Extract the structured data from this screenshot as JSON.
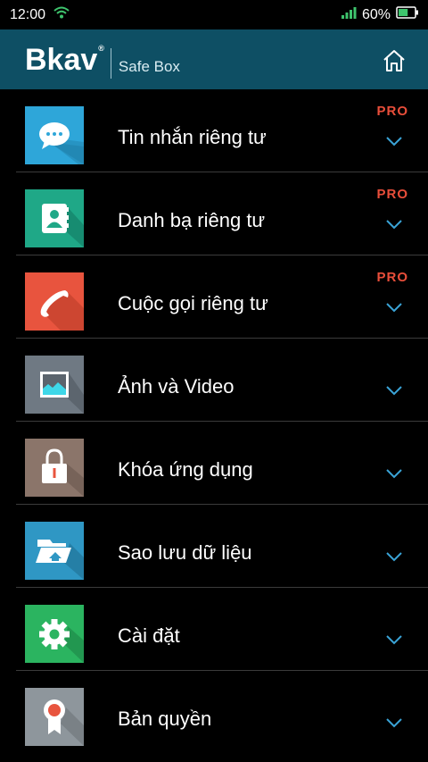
{
  "status_bar": {
    "time": "12:00",
    "battery": "60%",
    "battery_level": 0.6
  },
  "header": {
    "logo_text": "Bkav",
    "logo_reg": "®",
    "product_name": "Safe Box"
  },
  "colors": {
    "header_bg": "#0e4f64",
    "pro_badge": "#e94e3a",
    "chevron": "#3aa3d6",
    "messages_tile": "#2ea6d9",
    "contacts_tile": "#1fa887",
    "calls_tile": "#e8543e",
    "photos_tile": "#6f7983",
    "applock_tile": "#8b756a",
    "backup_tile": "#2f97c4",
    "settings_tile": "#2bb460",
    "license_tile": "#8e969c"
  },
  "menu": {
    "items": [
      {
        "label": "Tin nhắn riêng tư",
        "badge": "PRO",
        "icon": "chat-bubble-icon"
      },
      {
        "label": "Danh bạ riêng tư",
        "badge": "PRO",
        "icon": "contact-book-icon"
      },
      {
        "label": "Cuộc gọi riêng tư",
        "badge": "PRO",
        "icon": "phone-handset-icon"
      },
      {
        "label": "Ảnh và Video",
        "badge": "",
        "icon": "photo-icon"
      },
      {
        "label": "Khóa ứng dụng",
        "badge": "",
        "icon": "padlock-icon"
      },
      {
        "label": "Sao lưu dữ liệu",
        "badge": "",
        "icon": "folder-backup-icon"
      },
      {
        "label": "Cài đặt",
        "badge": "",
        "icon": "gear-icon"
      },
      {
        "label": "Bản quyền",
        "badge": "",
        "icon": "award-ribbon-icon"
      }
    ]
  }
}
